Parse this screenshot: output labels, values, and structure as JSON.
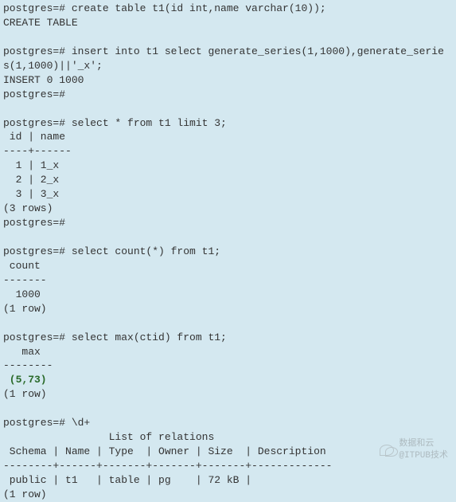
{
  "terminal": {
    "lines": [
      {
        "text": "postgres=# create table t1(id int,name varchar(10));"
      },
      {
        "text": "CREATE TABLE"
      },
      {
        "text": ""
      },
      {
        "text": "postgres=# insert into t1 select generate_series(1,1000),generate_serie"
      },
      {
        "text": "s(1,1000)||'_x';"
      },
      {
        "text": "INSERT 0 1000"
      },
      {
        "text": "postgres=#"
      },
      {
        "text": ""
      },
      {
        "text": "postgres=# select * from t1 limit 3;"
      },
      {
        "text": " id | name"
      },
      {
        "text": "----+------"
      },
      {
        "text": "  1 | 1_x"
      },
      {
        "text": "  2 | 2_x"
      },
      {
        "text": "  3 | 3_x"
      },
      {
        "text": "(3 rows)"
      },
      {
        "text": "postgres=#"
      },
      {
        "text": ""
      },
      {
        "text": "postgres=# select count(*) from t1;"
      },
      {
        "text": " count"
      },
      {
        "text": "-------"
      },
      {
        "text": "  1000"
      },
      {
        "text": "(1 row)"
      },
      {
        "text": ""
      },
      {
        "text": "postgres=# select max(ctid) from t1;"
      },
      {
        "text": "   max"
      },
      {
        "text": "--------"
      },
      {
        "text": " (5,73)",
        "bold": true
      },
      {
        "text": "(1 row)"
      },
      {
        "text": ""
      },
      {
        "text": "postgres=# \\d+"
      },
      {
        "text": "                 List of relations"
      },
      {
        "text": " Schema | Name | Type  | Owner | Size  | Description"
      },
      {
        "text": "--------+------+-------+-------+-------+-------------"
      },
      {
        "text": " public | t1   | table | pg    | 72 kB |"
      },
      {
        "text": "(1 row)"
      }
    ]
  },
  "watermark": {
    "label": "数据和云",
    "sub": "@ITPUB技术"
  }
}
